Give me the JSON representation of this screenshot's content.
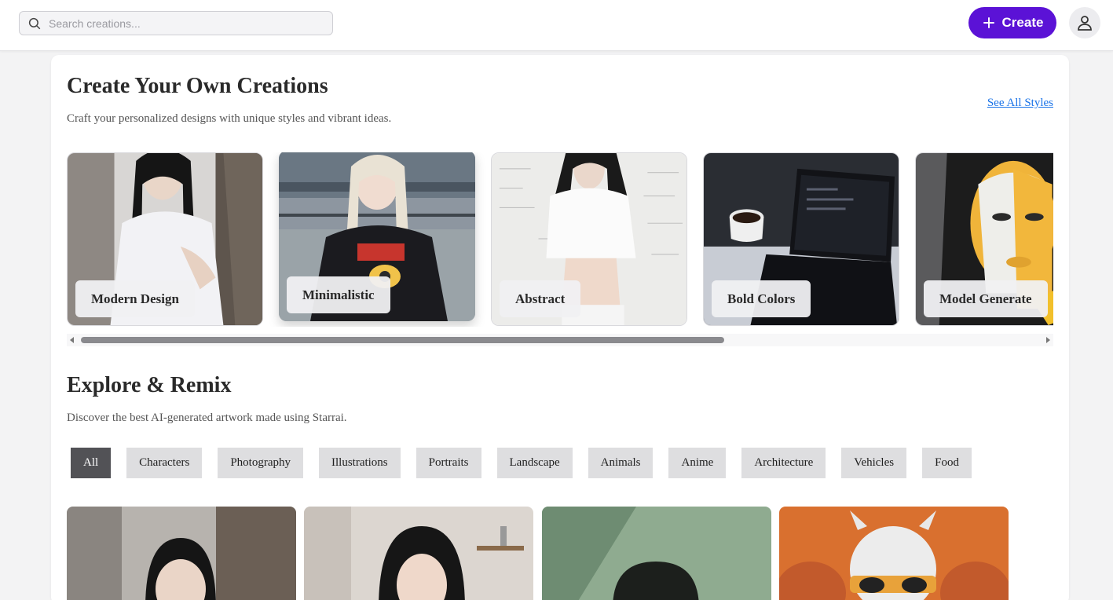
{
  "header": {
    "search_placeholder": "Search creations...",
    "create_label": "Create"
  },
  "styles_section": {
    "title": "Create Your Own Creations",
    "subtitle": "Craft your personalized designs with unique styles and vibrant ideas.",
    "see_all": "See All Styles",
    "cards": [
      {
        "label": "Modern Design"
      },
      {
        "label": "Minimalistic"
      },
      {
        "label": "Abstract"
      },
      {
        "label": "Bold Colors"
      },
      {
        "label": "Model Generate"
      }
    ]
  },
  "explore_section": {
    "title": "Explore & Remix",
    "subtitle": "Discover the best AI-generated artwork made using Starrai.",
    "filters": [
      "All",
      "Characters",
      "Photography",
      "Illustrations",
      "Portraits",
      "Landscape",
      "Animals",
      "Anime",
      "Architecture",
      "Vehicles",
      "Food"
    ],
    "active_filter": "All"
  },
  "colors": {
    "accent": "#5b12d6",
    "link": "#1a73e8",
    "active_chip": "#525256",
    "chip": "#dedee0"
  }
}
